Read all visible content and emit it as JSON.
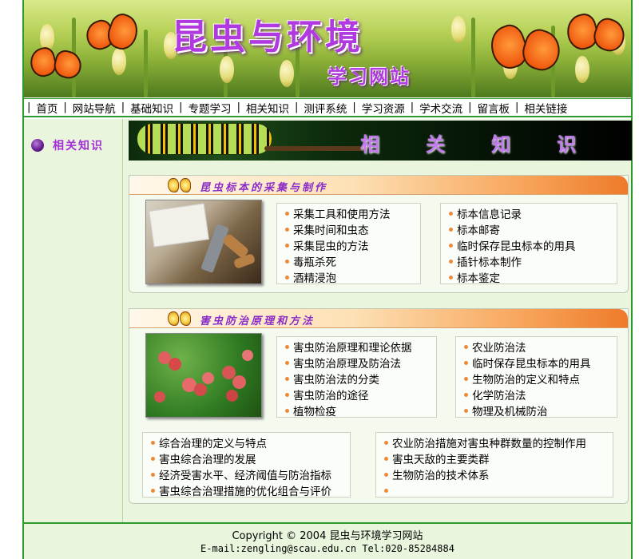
{
  "banner": {
    "title": "昆虫与环境",
    "subtitle": "学习网站"
  },
  "nav": {
    "items": [
      "首页",
      "网站导航",
      "基础知识",
      "专题学习",
      "相关知识",
      "测评系统",
      "学习资源",
      "学术交流",
      "留言板",
      "相关链接"
    ]
  },
  "left": {
    "label": "相关知识",
    "icon": "purple-orb-icon"
  },
  "main": {
    "banner_title": "相关知识",
    "sections": [
      {
        "title": "昆虫标本的采集与制作",
        "photo": "specimen-tools-photo",
        "left_list": [
          "采集工具和使用方法",
          "采集时间和虫态",
          "采集昆虫的方法",
          "毒瓶杀死",
          "酒精浸泡"
        ],
        "right_list": [
          "标本信息记录",
          "标本邮寄",
          "临时保存昆虫标本的用具",
          "插针标本制作",
          "标本鉴定"
        ]
      },
      {
        "title": "害虫防治原理和方法",
        "photo": "lychee-fruit-photo",
        "left_list": [
          "害虫防治原理和理论依据",
          "害虫防治原理及防治法",
          "害虫防治法的分类",
          "害虫防治的途径",
          "植物检疫"
        ],
        "right_list": [
          "农业防治法",
          "临时保存昆虫标本的用具",
          "生物防治的定义和特点",
          "化学防治法",
          "物理及机械防治"
        ],
        "bottom_left_list": [
          "综合治理的定义与特点",
          "害虫综合治理的发展",
          "经济受害水平、经济阈值与防治指标",
          "害虫综合治理措施的优化组合与评价"
        ],
        "bottom_right_list": [
          "农业防治措施对害虫种群数量的控制作用",
          "害虫天敌的主要类群",
          "生物防治的技术体系",
          ""
        ]
      }
    ]
  },
  "footer": {
    "copyright": "Copyright ©  2004 昆虫与环境学习网站",
    "contact": "E-mail:zengling@scau.edu.cn    Tel:020-85284884"
  },
  "colors": {
    "accent_purple": "#a42ed8",
    "border_green": "#2e9a2e",
    "panel_bg": "#eaf5dd",
    "bullet_orange": "#ec8a3a"
  }
}
